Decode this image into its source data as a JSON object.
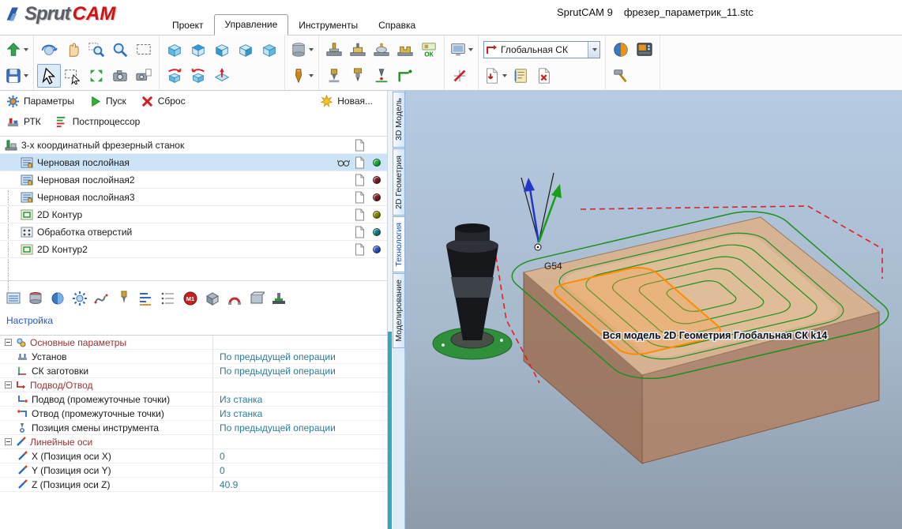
{
  "window": {
    "app_title": "SprutCAM 9",
    "doc_title": "фрезер_параметрик_11.stc"
  },
  "logo": {
    "text_sprut": "Sprut",
    "text_cam": "CAM"
  },
  "menu": {
    "project": "Проект",
    "control": "Управление",
    "tools": "Инструменты",
    "help": "Справка"
  },
  "toolbar": {
    "cs_selector_value": "Глобальная СК",
    "ok_badge": "ОК"
  },
  "job_bar": {
    "parameters": "Параметры",
    "start": "Пуск",
    "reset": "Сброс",
    "new_operation": "Новая...",
    "rtk": "РТК",
    "postprocessor": "Постпроцессор"
  },
  "operations_tree": {
    "machine": "3-х координатный фрезерный станок",
    "items": [
      {
        "label": "Черновая послойная",
        "status_color": "#1fae3a",
        "selected": true
      },
      {
        "label": "Черновая послойная2",
        "status_color": "#7a1f24",
        "selected": false
      },
      {
        "label": "Черновая послойная3",
        "status_color": "#7a1f24",
        "selected": false
      },
      {
        "label": "2D Контур",
        "status_color": "#8a8a00",
        "selected": false
      },
      {
        "label": "Обработка отверстий",
        "status_color": "#0f7f86",
        "selected": false
      },
      {
        "label": "2D Контур2",
        "status_color": "#2f55c8",
        "selected": false
      }
    ]
  },
  "mini_bar": {
    "m1_badge": "M1"
  },
  "setup_link": "Настройка",
  "parameters_grid": {
    "groups": [
      {
        "label": "Основные параметры",
        "items": [
          {
            "name": "Установ",
            "value": "По предыдущей операции"
          },
          {
            "name": "СК заготовки",
            "value": "По предыдущей операции"
          }
        ]
      },
      {
        "label": "Подвод/Отвод",
        "items": [
          {
            "name": "Подвод (промежуточные точки)",
            "value": "Из станка"
          },
          {
            "name": "Отвод (промежуточные точки)",
            "value": "Из станка"
          },
          {
            "name": "Позиция смены инструмента",
            "value": "По предыдущей операции"
          }
        ]
      },
      {
        "label": "Линейные оси",
        "items": [
          {
            "name": "X (Позиция оси X)",
            "value": "0"
          },
          {
            "name": "Y (Позиция оси Y)",
            "value": "0"
          },
          {
            "name": "Z (Позиция оси Z)",
            "value": "40.9"
          }
        ]
      }
    ]
  },
  "view_tabs": [
    {
      "label": "3D Модель",
      "active": false
    },
    {
      "label": "2D Геометрия",
      "active": false
    },
    {
      "label": "Технология",
      "active": true
    },
    {
      "label": "Моделирование",
      "active": false
    }
  ],
  "scene": {
    "wcs_label": "G54",
    "status_text": "Вся модель 2D Геометрия Глобальная СК k14",
    "colors": {
      "toolpath": "#1f8f1f",
      "rapid": "#e02020",
      "highlight": "#ff8c00"
    }
  }
}
